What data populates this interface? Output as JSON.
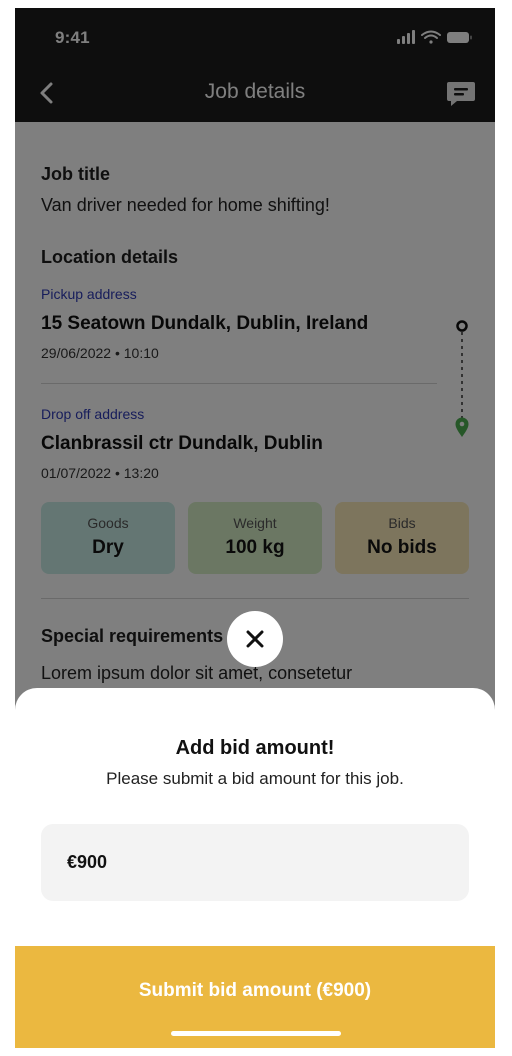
{
  "status_bar": {
    "time": "9:41"
  },
  "app_bar": {
    "title": "Job details"
  },
  "job": {
    "title_heading": "Job title",
    "title": "Van driver needed for home shifting!",
    "location_heading": "Location details",
    "pickup": {
      "label": "Pickup address",
      "address": "15 Seatown Dundalk, Dublin, Ireland",
      "datetime": "29/06/2022 • 10:10"
    },
    "dropoff": {
      "label": "Drop off address",
      "address": "Clanbrassil ctr Dundalk, Dublin",
      "datetime": "01/07/2022 • 13:20"
    },
    "stats": [
      {
        "label": "Goods",
        "value": "Dry",
        "color": "#c9ede7"
      },
      {
        "label": "Weight",
        "value": "100 kg",
        "color": "#d6efc6"
      },
      {
        "label": "Bids",
        "value": "No bids",
        "color": "#faeaba"
      }
    ],
    "special_heading": "Special requirements",
    "special_text": "Lorem ipsum dolor sit amet, consetetur"
  },
  "bid_sheet": {
    "title": "Add bid amount!",
    "subtitle": "Please submit a bid amount for this job.",
    "amount_value": "€900",
    "submit_label": "Submit bid amount (€900)"
  },
  "colors": {
    "header_bg": "#1d1d1d",
    "accent_button": "#ebb840",
    "link_label": "#2f3bb6",
    "route_start": "#111111",
    "route_end": "#4caf50"
  }
}
